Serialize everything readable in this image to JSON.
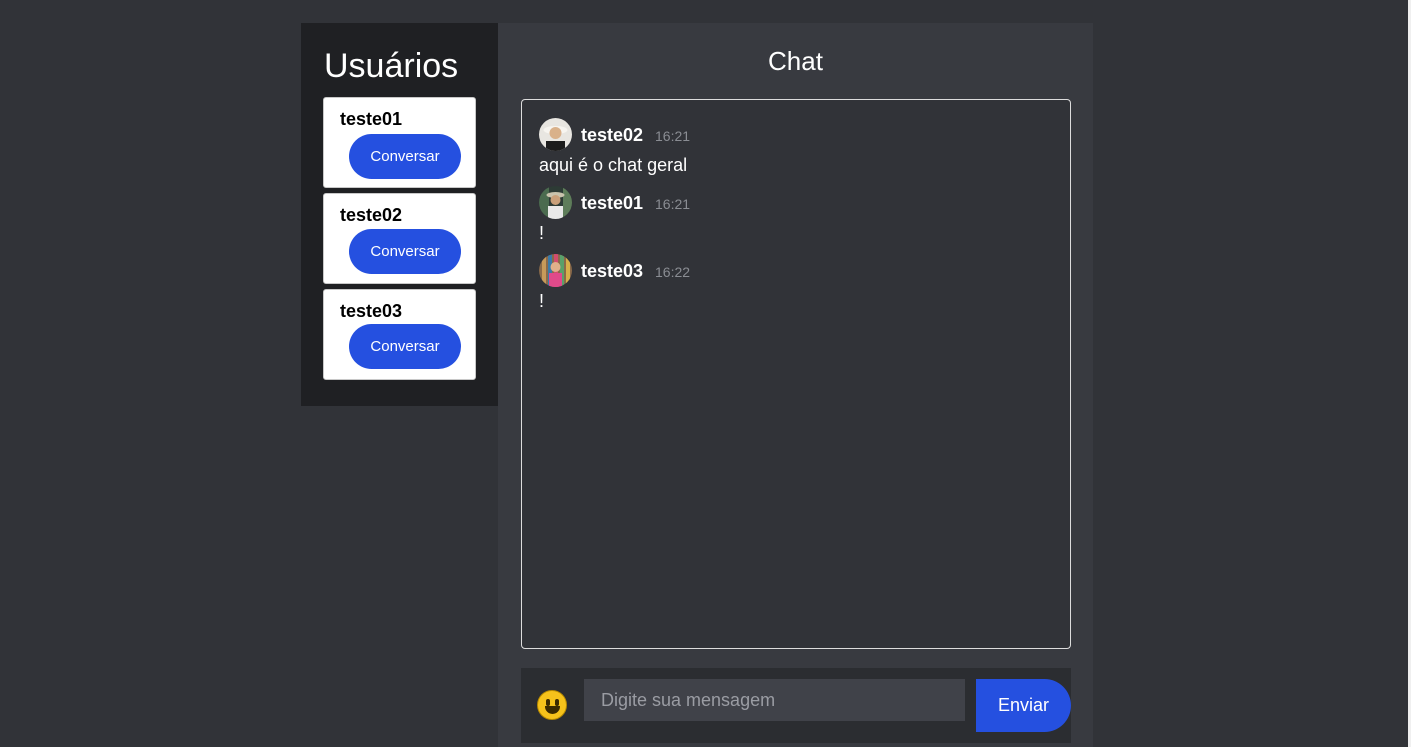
{
  "sidebar": {
    "title": "Usuários",
    "users": [
      {
        "name": "teste01",
        "button_label": "Conversar"
      },
      {
        "name": "teste02",
        "button_label": "Conversar"
      },
      {
        "name": "teste03",
        "button_label": "Conversar"
      }
    ]
  },
  "chat": {
    "title": "Chat",
    "messages": [
      {
        "author": "teste02",
        "time": "16:21",
        "text": "aqui é o chat geral",
        "avatar": "avatar-photo"
      },
      {
        "author": "teste01",
        "time": "16:21",
        "text": "!",
        "avatar": "avatar-photo"
      },
      {
        "author": "teste03",
        "time": "16:22",
        "text": "!",
        "avatar": "avatar-photo"
      }
    ]
  },
  "composer": {
    "placeholder": "Digite sua mensagem",
    "value": "",
    "send_label": "Enviar",
    "emoji_icon": "smiley-icon"
  },
  "colors": {
    "accent": "#2550e0",
    "background": "#313338",
    "sidebar": "#1f2023",
    "panel": "#383a40"
  }
}
